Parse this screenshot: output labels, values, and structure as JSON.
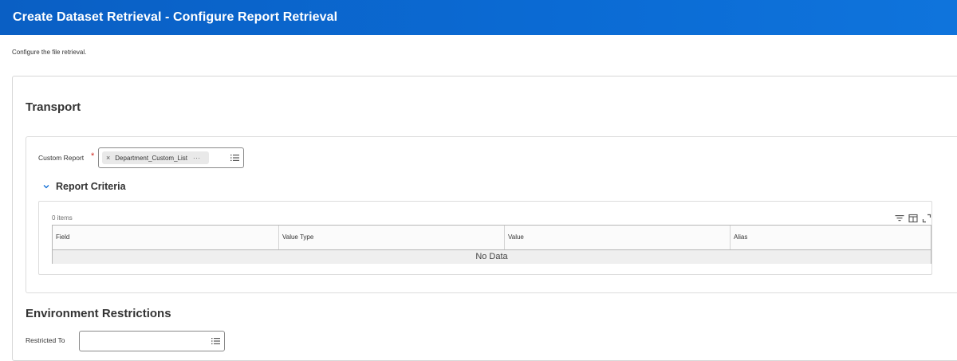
{
  "header": {
    "title": "Create Dataset Retrieval - Configure Report Retrieval"
  },
  "subtitle": "Configure the file retrieval.",
  "transport": {
    "title": "Transport",
    "custom_report": {
      "label": "Custom Report",
      "required_marker": "*",
      "selected_value": "Department_Custom_List",
      "remove_glyph": "×",
      "more_glyph": "···"
    },
    "report_criteria": {
      "title": "Report Criteria",
      "items_count": "0 items",
      "columns": [
        "Field",
        "Value Type",
        "Value",
        "Alias"
      ],
      "empty_text": "No Data"
    }
  },
  "environment": {
    "title": "Environment Restrictions",
    "restricted_to": {
      "label": "Restricted To",
      "value": ""
    }
  },
  "colors": {
    "header_blue": "#0b6bd4",
    "required_red": "#d0271d"
  },
  "icons": [
    "prompt-list-icon",
    "chevron-down-icon",
    "filter-icon",
    "column-settings-icon",
    "fullscreen-icon"
  ]
}
